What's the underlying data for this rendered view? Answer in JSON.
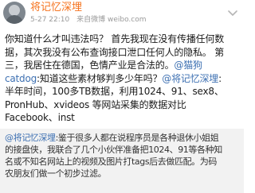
{
  "header": {
    "author": "将记忆深埋",
    "time": "5-27 22:10",
    "source": "来自微博 weibo.com"
  },
  "post": {
    "lines": [
      [
        "你知道什么才叫违法吗？ 首先我现在没有传播任何数"
      ],
      [
        "据，其次我没有公布查询接口泄口任何人的隐私。 第"
      ],
      [
        "三，我居住在德国，色情产业是合法的。",
        "@猫狗"
      ],
      [
        "catdog",
        ":知道这些素材够判多少年吗？",
        "@将记忆深埋",
        ":"
      ],
      [
        "半年时间，100多TB数据，利用1024、91、sex8、"
      ],
      [
        "PronHub、xvideos 等网站采集的数据对比"
      ],
      [
        "Facebook、inst"
      ]
    ]
  },
  "repost": {
    "mention": "@将记忆深埋",
    "lines": [
      ":鉴于很多人都在说程序员是各种退休小姐姐",
      "的接盘侠，我联合了几个小伙伴准备把1024、91等各种知",
      "名或不知名网站上的视频及图片打tags后去做匹配。为码",
      "农朋友们做一个初步过滤。"
    ]
  }
}
